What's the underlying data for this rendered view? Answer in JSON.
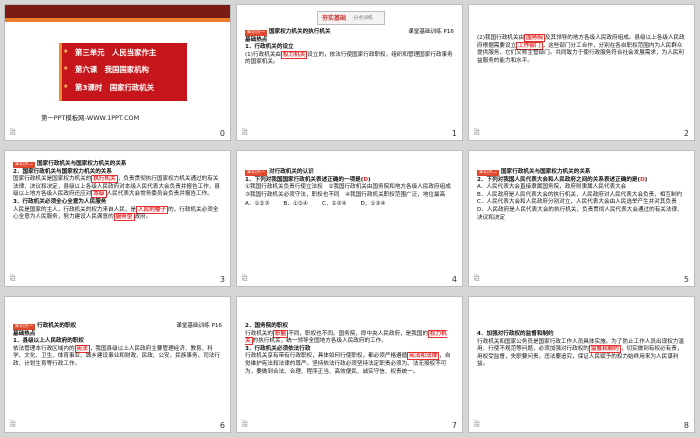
{
  "footer_icon": "治",
  "slides": [
    {
      "number": "0",
      "unit_title": "第三单元　人民当家作主",
      "chapter_title": "第六课　我国国家机构",
      "lesson_title": "第3课时　国家行政机关",
      "website": "第一PPT模板网-WWW.1PPT.COM"
    },
    {
      "number": "1",
      "banner": "夯实基础",
      "banner_sub": "·分点训练",
      "point_tag": "知识点一",
      "point_title": "国家权力机关的执行机关",
      "reference": "课堂基础训练 P16",
      "section": "基础热点",
      "q1": "1．行政机关的设立",
      "q1_body": "(1)行政机关由",
      "q1_answer": "权力机关",
      "q1_rest": "设立的，依法行使国家行政职权，组织和管理国家行政事务的国家机关。"
    },
    {
      "number": "2",
      "t1": "(2)我国行政机关由",
      "a1": "国务院",
      "t2": "及其领导的地方各级人民政府组成。县级以上各级人民政府根据需要设立",
      "a2": "工作部门",
      "t3": "，这些部门分工合作，分别在各自职权范围内为人民群众提供服务，它们又称主管部门。共同致力于使行政服务符合社会发展需求，为人民利益服务的能力和水平。"
    },
    {
      "number": "3",
      "tag": "知识点二",
      "title": "国家行政机关与国家权力机关的关系",
      "p2": "2．国家行政机关与国家权力机关的关系",
      "p2_body1": "国家行政机关是国家权力机关的",
      "a1": "执行机关",
      "p2_body2": "，负责贯彻执行国家权力机关通过的有关法律、决议和决定，县级以上各级人民政府对本级人民代表大会负责并报告工作，县级以上地方各级人民政府还应对",
      "a2": "本级",
      "p2_body3": "人民代表大会常务委员会负责并报告工作。",
      "p3": "3．行政机关必须全心全意为人民服务",
      "p3_body1": "人民是国家的主人，行政机关的权力来自人民，是",
      "a3": "人民的楼子",
      "p3_body2": "的，行政机关必须全心全意为人民服务，努力建设人民满意的",
      "a4": "服务型",
      "p3_body3": "政府。"
    },
    {
      "number": "4",
      "tag": "知识点一",
      "title": "对行政机关的认识",
      "q": "1．下列对我国国家行政机关表述正确的一项是(",
      "answer": "D",
      "q_end": ")",
      "o1": "①我国行政机关负责行使立法权　②我国行政机关由国务院和地方各级人民政府组成　③我国行政机关必须守法，职权也不同　④我国行政机关职权范围广泛，地位最高",
      "choices": [
        "A．①②③",
        "B．①②④",
        "C．②③④",
        "D．①③④"
      ]
    },
    {
      "number": "5",
      "tag": "知识点二",
      "title": "国家行政机关与国家权力机关的关系",
      "q": "2．下列对我国人民代表大会和人民政府之间的关系表述正确的是(",
      "answer": "D",
      "q_end": ")",
      "options": [
        "A．人民代表大会直接隶属国务院，政府则隶属人民代表大会",
        "B．人民政府是人民代表大会的执行机关，人民政府对人民代表大会负责，相互制约",
        "C．人民代表大会和人民政府分别对立，人民代表大会由人民选举产生并对其负责",
        "D．人民政府是人民代表大会的执行机关，负责贯彻人民代表大会通过的有关法律、决议和决定"
      ]
    },
    {
      "number": "6",
      "tag": "知识点一",
      "title": "行政机关的职权",
      "reference": "课堂基础训练 P16",
      "section": "基础热点",
      "p1": "1．县级以上人民政府的职权",
      "body1": "依法管理本行政区域内的",
      "a1": "宪法",
      "body2": "，我国县级以上人民政府主要管理经济、教育、科学、文化、卫生、体育事业、城乡建设事业和财政、民政、公安、民族事务、司法行政、计划生育等行政工作。"
    },
    {
      "number": "7",
      "p2": "2．国务院的职权",
      "body1": "行政机关的",
      "a1": "职能",
      "body2": "不同，职权也不同。国务院，即中央人民政府，是我国的",
      "a2": "权力机关",
      "body3": "的执行机关，统一领导全国地方各级人民政府的工作。",
      "p3": "3．行政机关必须依法行政",
      "body4": "行政机关享有带有行政职权，具体如何行使职权，都必须严格遵循",
      "a3": "宪法和法律",
      "body5": "，自觉维护宪法和法律的尊严。坚持依法行政必须坚持法定职责必须为、法无授权不可为，要做到合法、合理、程序正当、高效便民、诚实守信、权责统一。"
    },
    {
      "number": "8",
      "p4": "4．加强对行政权的监督和制约",
      "body1": "行政机关和国家公务员是国家行政工作人员具体实施。为了防止工作人员出现权力滥用、行使不规范等问题，必须加强对行政权的",
      "a1": "监督和制约",
      "body2": "，切实做到有权必有责，用权受监督，失职要问责，违法要追究，保证人民赋予的权力始终用来为人民谋利益。"
    }
  ]
}
